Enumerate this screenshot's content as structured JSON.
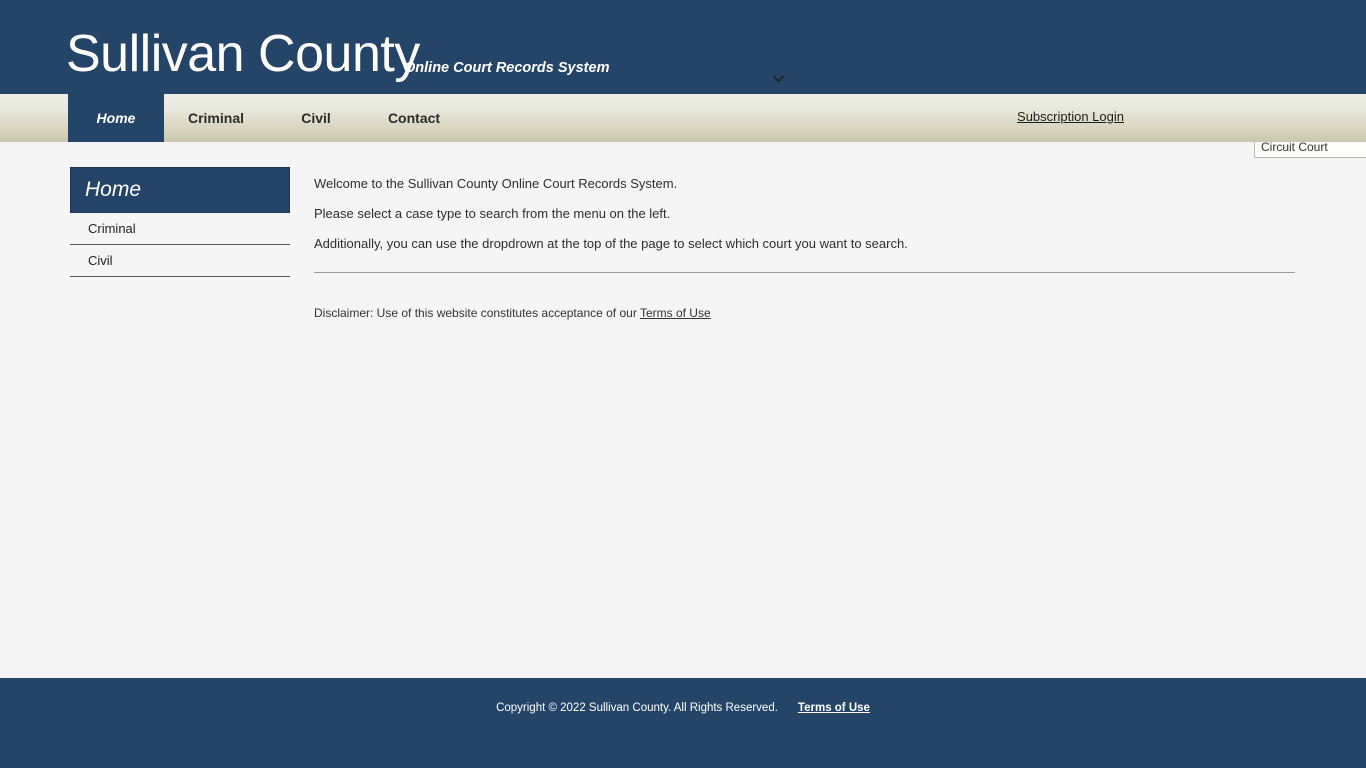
{
  "header": {
    "title": "Sullivan County",
    "subtitle": "Online Court Records System",
    "court_select": {
      "selected": "Circuit Court",
      "options": [
        "Circuit Court"
      ],
      "icon": "chevron-down-icon"
    },
    "background_color": "#254568"
  },
  "nav": {
    "items": [
      {
        "label": "Home",
        "active": true
      },
      {
        "label": "Criminal",
        "active": false
      },
      {
        "label": "Civil",
        "active": false
      },
      {
        "label": "Contact",
        "active": false
      }
    ],
    "subscription_login": "Subscription Login"
  },
  "sidebar": {
    "header": "Home",
    "items": [
      {
        "label": "Criminal"
      },
      {
        "label": "Civil"
      }
    ]
  },
  "main": {
    "paragraphs": [
      "Welcome to the Sullivan County Online Court Records System.",
      "Please select a case type to search from the menu on the left.",
      "Additionally, you can use the dropdrown at the top of the page to select which court you want to search."
    ],
    "disclaimer_text": "Disclaimer: Use of this website constitutes acceptance of our ",
    "disclaimer_link": "Terms of Use"
  },
  "footer": {
    "copyright": "Copyright © 2022 Sullivan County. All Rights Reserved.",
    "terms_link": "Terms of Use"
  },
  "colors": {
    "navy": "#254568",
    "nav_gradient_top": "#eef0e7",
    "nav_gradient_bottom": "#cbc7ac",
    "body_background": "#f5f5f5"
  }
}
